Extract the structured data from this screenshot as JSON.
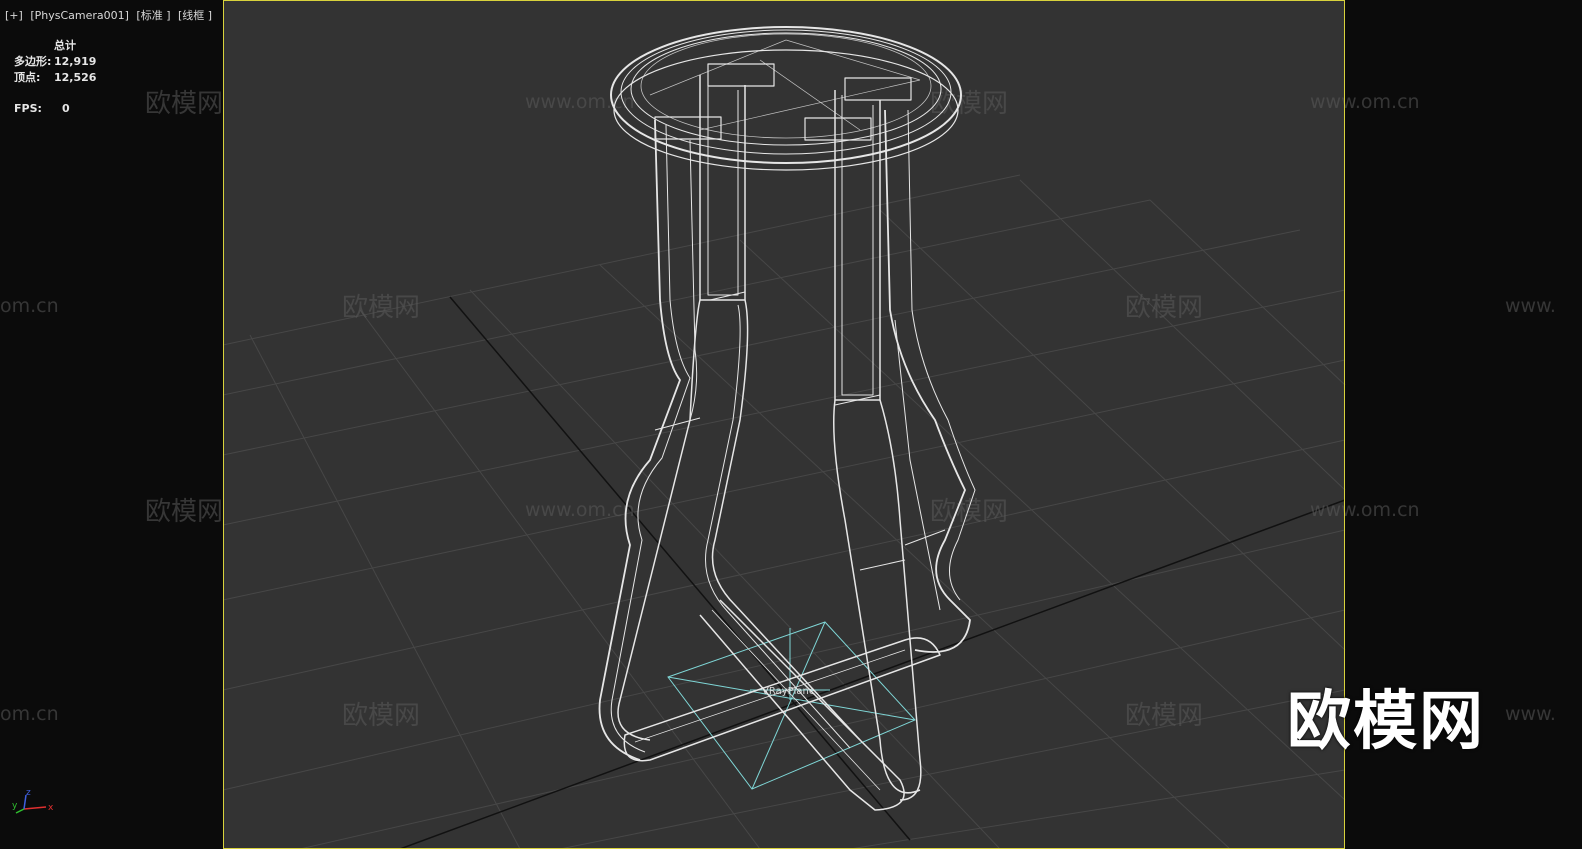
{
  "viewport": {
    "labels": [
      "[+]",
      "[PhysCamera001]",
      "[标准 ]",
      "[线框 ]"
    ]
  },
  "stats": {
    "header": "总计",
    "polygons_label": "多边形:",
    "polygons": "12,919",
    "vertices_label": "顶点:",
    "vertices": "12,526",
    "fps_label": "FPS:",
    "fps": "0"
  },
  "scene": {
    "object_label": "VRayPlane",
    "watermark_cn": "欧模网",
    "watermark_url": "www.om.cn",
    "watermark_url_short": "om.cn",
    "watermark_url_prefix": "www.",
    "frame_color": "#d8d23c",
    "grid_color": "#4a4a4a",
    "wire_color": "#e8e8e8",
    "plane_color": "#7fd6d6"
  },
  "logo": {
    "text": "欧模网"
  },
  "axis_gizmo": {
    "x": "x",
    "y": "y",
    "z": "z"
  }
}
